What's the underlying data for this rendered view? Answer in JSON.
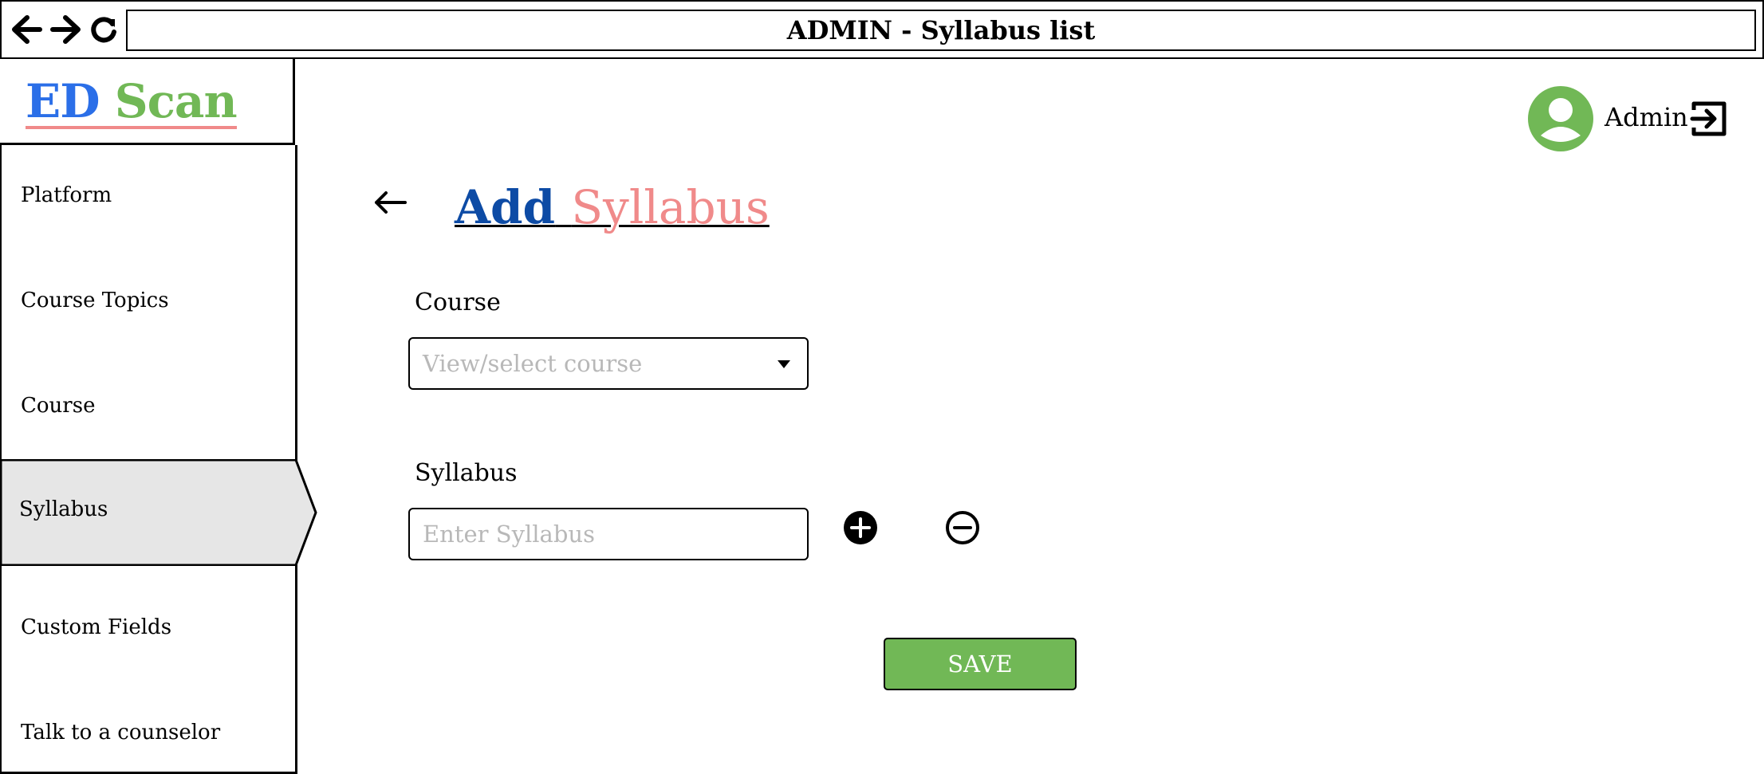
{
  "browser": {
    "title": "ADMIN - Syllabus list"
  },
  "logo": {
    "part1": "ED",
    "part2": "Scan"
  },
  "sidebar": {
    "items": [
      {
        "label": "Platform"
      },
      {
        "label": "Course Topics"
      },
      {
        "label": "Course"
      },
      {
        "label": "Syllabus",
        "active": true
      },
      {
        "label": "Custom Fields"
      },
      {
        "label": "Talk to a counselor"
      }
    ]
  },
  "user": {
    "name": "Admin",
    "avatar_icon": "user-avatar-icon",
    "logout_icon": "logout-icon"
  },
  "page": {
    "title_part1": "Add",
    "title_part2": "Syllabus",
    "back_icon": "arrow-left-icon"
  },
  "form": {
    "course_label": "Course",
    "course_placeholder": "View/select course",
    "syllabus_label": "Syllabus",
    "syllabus_placeholder": "Enter Syllabus",
    "add_icon": "plus-circle-icon",
    "remove_icon": "minus-circle-icon",
    "save_label": "SAVE"
  },
  "colors": {
    "brand_blue": "#2b6fe8",
    "brand_green": "#71b856",
    "title_blue": "#0d4ba5",
    "accent_pink": "#f08a8a",
    "active_bg": "#e6e6e6"
  }
}
